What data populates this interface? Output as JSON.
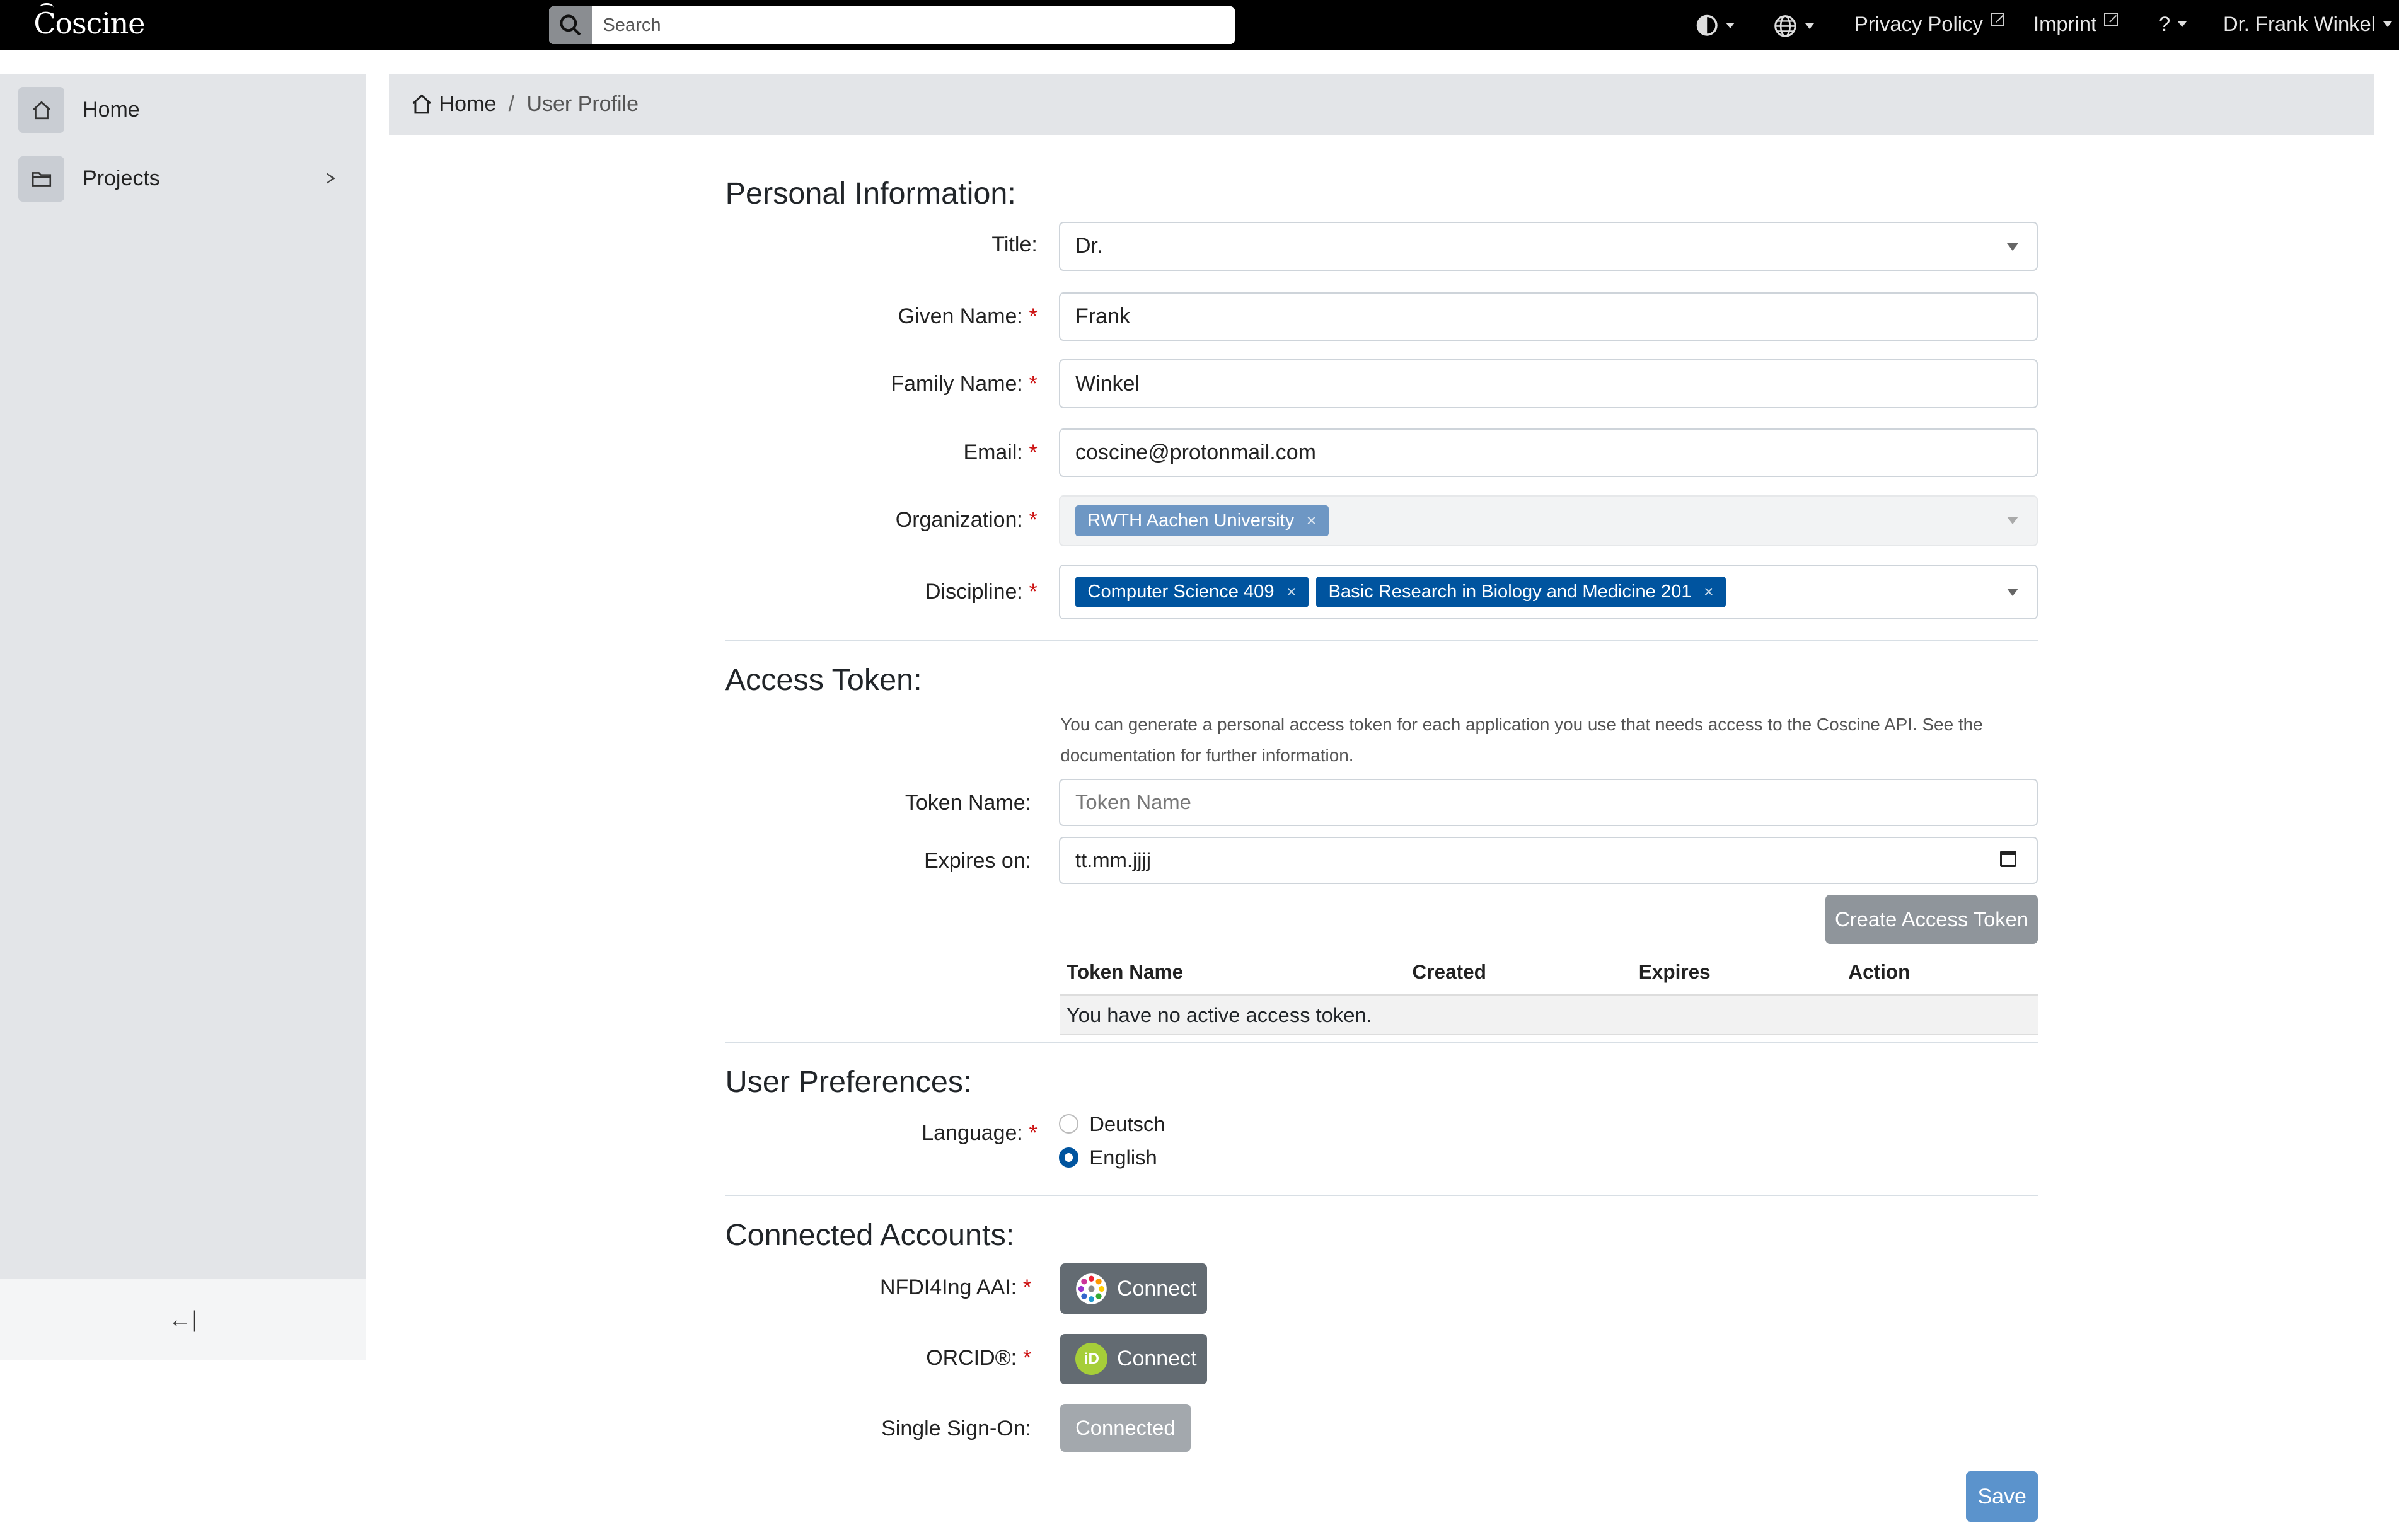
{
  "header": {
    "logo": "Coscine",
    "search_placeholder": "Search",
    "privacy_policy": "Privacy Policy",
    "imprint": "Imprint",
    "help": "?",
    "user": "Dr. Frank Winkel"
  },
  "sidebar": {
    "items": [
      {
        "label": "Home"
      },
      {
        "label": "Projects"
      }
    ],
    "collapse_label": "←|"
  },
  "breadcrumb": {
    "home": "Home",
    "separator": "/",
    "current": "User Profile"
  },
  "personal": {
    "heading": "Personal Information:",
    "title_label": "Title:",
    "title_value": "Dr.",
    "given_label": "Given Name:",
    "given_value": "Frank",
    "family_label": "Family Name:",
    "family_value": "Winkel",
    "email_label": "Email:",
    "email_value": "coscine@protonmail.com",
    "org_label": "Organization:",
    "org_tags": [
      "RWTH Aachen University"
    ],
    "discipline_label": "Discipline:",
    "discipline_tags": [
      "Computer Science 409",
      "Basic Research in Biology and Medicine 201"
    ],
    "required_mark": "*",
    "remove_mark": "×"
  },
  "token": {
    "heading": "Access Token:",
    "help": "You can generate a personal access token for each application you use that needs access to the Coscine API. See the documentation for further information.",
    "name_label": "Token Name:",
    "name_placeholder": "Token Name",
    "expires_label": "Expires on:",
    "expires_value": "tt.mm.jjjj",
    "create_button": "Create Access Token",
    "columns": [
      "Token Name",
      "Created",
      "Expires",
      "Action"
    ],
    "empty": "You have no active access token."
  },
  "prefs": {
    "heading": "User Preferences:",
    "language_label": "Language:",
    "options": [
      "Deutsch",
      "English"
    ],
    "selected": "English"
  },
  "accounts": {
    "heading": "Connected Accounts:",
    "nfdi_label": "NFDI4Ing AAI:",
    "orcid_label": "ORCID®:",
    "sso_label": "Single Sign-On:",
    "connect": "Connect",
    "connected": "Connected",
    "orcid_icon_text": "iD"
  },
  "save_button": "Save",
  "colors": {
    "accent": "#00549f",
    "tag_light": "#6e97c4",
    "save": "#5b93cc"
  }
}
